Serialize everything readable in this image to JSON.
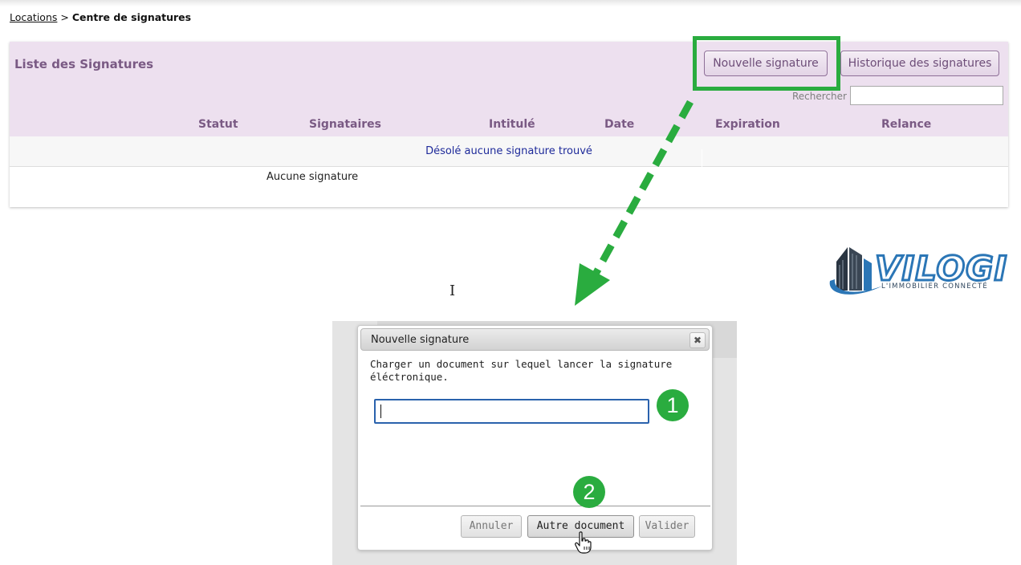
{
  "breadcrumb": {
    "link": "Locations",
    "separator": ">",
    "current": "Centre de signatures"
  },
  "panel": {
    "title": "Liste des Signatures",
    "new_button": "Nouvelle signature",
    "history_button": "Historique des signatures",
    "search_label": "Rechercher",
    "search_value": "",
    "columns": [
      "Statut",
      "Signataires",
      "Intitulé",
      "Date",
      "Expiration",
      "Relance"
    ],
    "empty_message": "Désolé aucune signature trouvé",
    "footer_text": "Aucune signature"
  },
  "logo": {
    "wordmark": "VILOGI",
    "tagline": "L'IMMOBILIER CONNECTÉ"
  },
  "dialog": {
    "title": "Nouvelle signature",
    "close_glyph": "✖",
    "message": "Charger un document sur lequel lancer la signature éléctronique.",
    "input_value": "",
    "buttons": {
      "cancel": "Annuler",
      "other_document": "Autre document",
      "validate": "Valider"
    }
  },
  "annotations": {
    "step1": "1",
    "step2": "2",
    "highlight_color": "#2aac3f"
  },
  "colors": {
    "panel_header_bg": "#ede0ef",
    "accent_purple": "#7a5a84",
    "empty_message_blue": "#1e2a9a",
    "logo_blue": "#2b76b6"
  },
  "icons": {
    "close": "close-icon",
    "text_cursor": "text-cursor-icon",
    "hand_cursor": "hand-pointer-icon",
    "arrow": "dashed-arrow-icon"
  }
}
